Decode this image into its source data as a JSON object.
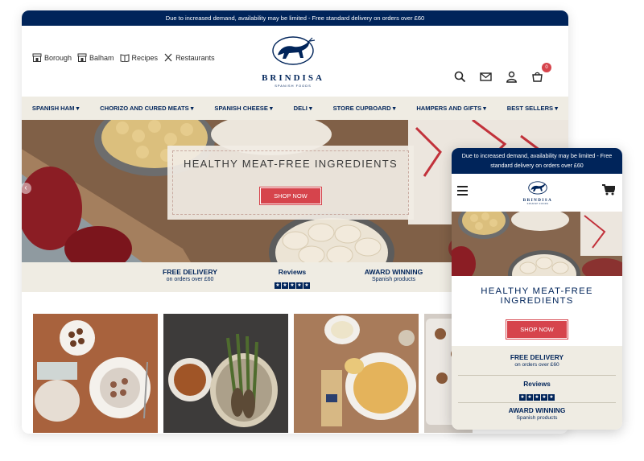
{
  "desktop": {
    "promo": "Due to increased demand, availability may be limited - Free standard delivery on orders over £60",
    "header_links": [
      {
        "label": "Borough",
        "icon": "store-icon"
      },
      {
        "label": "Balham",
        "icon": "store-icon"
      },
      {
        "label": "Recipes",
        "icon": "book-icon"
      },
      {
        "label": "Restaurants",
        "icon": "cutlery-icon"
      }
    ],
    "logo": {
      "name": "BRINDISA",
      "sub": "SPANISH FOODS"
    },
    "cart_count": "0",
    "nav": [
      "SPANISH HAM ▾",
      "CHORIZO AND CURED MEATS ▾",
      "SPANISH CHEESE ▾",
      "DELI ▾",
      "STORE CUPBOARD ▾",
      "HAMPERS AND GIFTS ▾",
      "BEST SELLERS ▾"
    ],
    "hero": {
      "title": "HEALTHY MEAT-FREE INGREDIENTS",
      "button": "SHOP NOW"
    },
    "usps": [
      {
        "title": "FREE DELIVERY",
        "sub": "on orders over £60"
      },
      {
        "title": "Reviews",
        "sub": ""
      },
      {
        "title": "AWARD WINNING",
        "sub": "Spanish products"
      }
    ],
    "rating_stars": 5
  },
  "mobile": {
    "promo": "Due to increased demand, availability may be limited - Free standard delivery on orders over £60",
    "logo": {
      "name": "BRINDISA",
      "sub": "SPANISH FOODS"
    },
    "hero_title": "HEALTHY MEAT-FREE INGREDIENTS",
    "button": "SHOP NOW",
    "usps": [
      {
        "title": "FREE DELIVERY",
        "sub": "on orders over £60"
      },
      {
        "title": "Reviews",
        "sub": ""
      },
      {
        "title": "AWARD WINNING",
        "sub": "Spanish products"
      }
    ]
  },
  "colors": {
    "navy": "#00245a",
    "accent_red": "#d6444c",
    "beige": "#efece3"
  }
}
